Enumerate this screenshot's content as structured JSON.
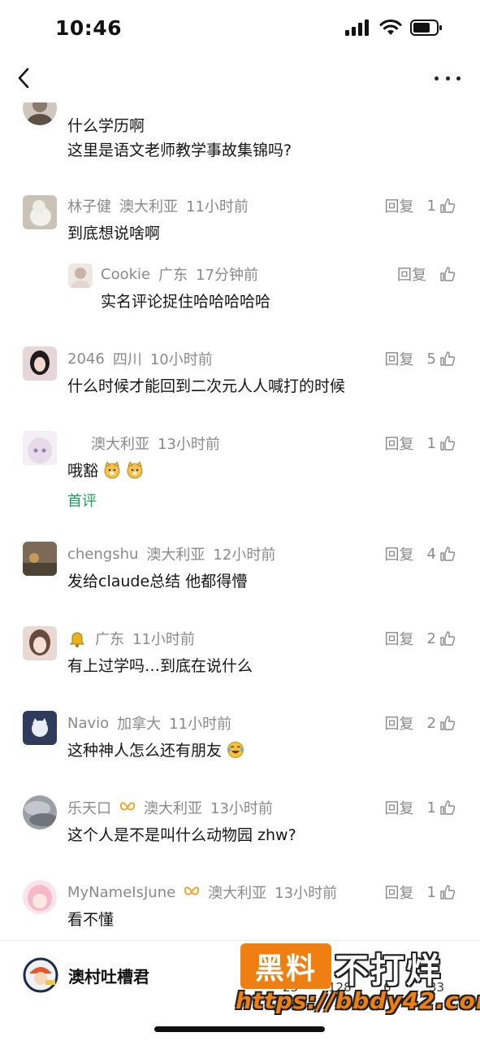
{
  "status": {
    "time": "10:46"
  },
  "reply_label": "回复",
  "comments": [
    {
      "user": "",
      "location": "",
      "time": "",
      "lines": [
        "什么学历啊",
        "这里是语文老师教学事故集锦吗?"
      ],
      "likes": ""
    },
    {
      "user": "林子健",
      "location": "澳大利亚",
      "time": "11小时前",
      "lines": [
        "到底想说啥啊"
      ],
      "likes": "1"
    },
    {
      "user": "Cookie",
      "location": "广东",
      "time": "17分钟前",
      "lines": [
        "实名评论捉住哈哈哈哈哈"
      ],
      "likes": ""
    },
    {
      "user": "2046",
      "location": "四川",
      "time": "10小时前",
      "lines": [
        "什么时候才能回到二次元人人喊打的时候"
      ],
      "likes": "5"
    },
    {
      "user": "",
      "location": "澳大利亚",
      "time": "13小时前",
      "lines": [
        "哦豁"
      ],
      "likes": "1",
      "tag": "首评"
    },
    {
      "user": "chengshu",
      "location": "澳大利亚",
      "time": "12小时前",
      "lines": [
        "发给claude总结 他都得懵"
      ],
      "likes": "4"
    },
    {
      "user": "",
      "location": "广东",
      "time": "11小时前",
      "lines": [
        "有上过学吗…到底在说什么"
      ],
      "likes": "2"
    },
    {
      "user": "Navio",
      "location": "加拿大",
      "time": "11小时前",
      "lines": [
        "这种神人怎么还有朋友"
      ],
      "likes": "2"
    },
    {
      "user": "乐天口",
      "location": "澳大利亚",
      "time": "13小时前",
      "lines": [
        "这个人是不是叫什么动物园 zhw?"
      ],
      "likes": "1"
    },
    {
      "user": "MyNameIsJune",
      "location": "澳大利亚",
      "time": "13小时前",
      "lines": [
        "看不懂"
      ],
      "likes": "1"
    }
  ],
  "bottom": {
    "account_name": "澳村吐槽君",
    "counts": [
      "23",
      "128",
      "6",
      "33"
    ]
  },
  "watermark": {
    "badge": "黑料",
    "right": "不打烊",
    "url": "https://bbdy42.com"
  },
  "colors": {
    "accent_green": "#19a05c",
    "watermark_orange": "#f07f12",
    "muted_text": "#8a8a8a"
  }
}
